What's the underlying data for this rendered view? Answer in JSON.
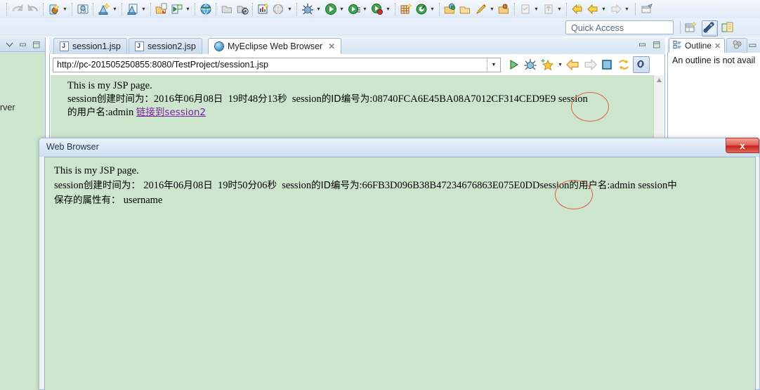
{
  "app": {
    "quick_access_placeholder": "Quick Access"
  },
  "toolbar": {
    "icons": [
      {
        "name": "undo-icon"
      },
      {
        "name": "redo-icon"
      },
      {
        "name": "new-java-bean-icon"
      },
      {
        "name": "html5-icon"
      },
      {
        "name": "new-wizard-icon"
      },
      {
        "name": "new-wizard-alt-icon"
      },
      {
        "name": "import-icon"
      },
      {
        "name": "export-icon"
      },
      {
        "name": "globe-deploy-icon"
      },
      {
        "name": "open-folder-icon"
      },
      {
        "name": "refresh-deploy-icon"
      },
      {
        "name": "report-icon"
      },
      {
        "name": "web-browser-icon"
      },
      {
        "name": "debug-icon"
      },
      {
        "name": "run-icon"
      },
      {
        "name": "run-history-icon"
      },
      {
        "name": "run-external-icon"
      },
      {
        "name": "new-table-icon"
      },
      {
        "name": "target-icon"
      },
      {
        "name": "open-type-icon"
      },
      {
        "name": "open-folder2-icon"
      },
      {
        "name": "pencil-icon"
      },
      {
        "name": "open-resource-icon"
      },
      {
        "name": "apply-patch-icon"
      },
      {
        "name": "up-nav-icon"
      },
      {
        "name": "back-yellow-icon"
      },
      {
        "name": "back-icon"
      },
      {
        "name": "forward-icon"
      },
      {
        "name": "pin-editor-icon"
      }
    ]
  },
  "perspective_bar": {
    "open_perspective": "open-perspective-icon",
    "myeclipse_perspective": "myeclipse-java-enterprise-icon",
    "java_perspective": "java-ee-perspective-icon"
  },
  "left_view": {
    "label_clipped": "rver",
    "buttons": [
      "view-menu-icon",
      "minimize-icon",
      "maximize-icon"
    ]
  },
  "editor": {
    "tabs": [
      {
        "label": "session1.jsp",
        "icon": "jsp-file-icon",
        "active": false,
        "closable": false
      },
      {
        "label": "session2.jsp",
        "icon": "jsp-file-icon",
        "active": false,
        "closable": false
      },
      {
        "label": "MyEclipse Web Browser",
        "icon": "web-browser-icon",
        "active": true,
        "closable": true,
        "close_glyph": "✕"
      }
    ],
    "view_buttons": [
      "minimize-icon",
      "maximize-icon"
    ],
    "url": "http://pc-201505250855:8080/TestProject/session1.jsp",
    "url_dropdown": "chevron-down-icon",
    "browser_buttons": [
      {
        "name": "run-icon"
      },
      {
        "name": "debug-icon"
      },
      {
        "name": "favorites-icon"
      },
      {
        "name": "favorites-dropdown-icon"
      },
      {
        "name": "back-icon"
      },
      {
        "name": "forward-icon"
      },
      {
        "name": "stop-icon"
      },
      {
        "name": "refresh-icon"
      },
      {
        "name": "link-icon"
      }
    ],
    "scroll_up": "scroll-up-arrow-icon",
    "page": {
      "line1": "This is my JSP page.",
      "line2_a": "session",
      "line2_b": "创建时间为：",
      "line2_c": "2016",
      "line2_d": "年",
      "line2_e": "06",
      "line2_f": "月",
      "line2_g": "08",
      "line2_h": "日",
      "line2_time": "19",
      "line2_shi": "时",
      "line2_min": "48",
      "line2_fen": "分",
      "line2_sec": "13",
      "line2_miao": "秒",
      "line2_idlabel_a": "session",
      "line2_idlabel_b": "的ID编号为",
      "line2_idvalue": ":08740FCA6E45BA08A7012CF314CED9E9",
      "line2_tail": "session",
      "line3_a": "的用户名",
      "line3_b": ":admin ",
      "line3_link": "链接到session2"
    }
  },
  "outline": {
    "tab_label": "Outline",
    "tab_icon": "outline-icon",
    "close_glyph": "✕",
    "second_tab_icon": "hierarchy-icon",
    "message": "An outline is not avail"
  },
  "dialog": {
    "title": "Web Browser",
    "close_label": "x",
    "page": {
      "line1": "This is my JSP page.",
      "line2_a": "session",
      "line2_b": "创建时间为： ",
      "line2_date": "2016",
      "line2_nian": "年",
      "line2_month": "06",
      "line2_yue": "月",
      "line2_day": "08",
      "line2_ri": "日",
      "line2_hh": "19",
      "line2_shi": "时",
      "line2_mm": "50",
      "line2_fen": "分",
      "line2_ss": "06",
      "line2_miao": "秒",
      "line2_idlabel_a": "session",
      "line2_idlabel_b": "的ID编号为",
      "line2_idvalue": ":66FB3D096B38B47234676863E075E0DD",
      "line2_user_a": "session",
      "line2_user_b": "的用户名",
      "line2_user_c": ":admin session",
      "line2_user_d": "中",
      "line3_a": "保存的属性有： ",
      "line3_b": "username"
    }
  },
  "annotations": [
    {
      "name": "session-id-highlight-1",
      "color": "#e05a52"
    },
    {
      "name": "session-id-highlight-2",
      "color": "#e05a52"
    }
  ],
  "colors": {
    "page_background": "#cde5cd",
    "chrome_blue": "#d6e4f3",
    "annotation_red": "#e05a52",
    "link_purple": "#7a1fa2"
  }
}
